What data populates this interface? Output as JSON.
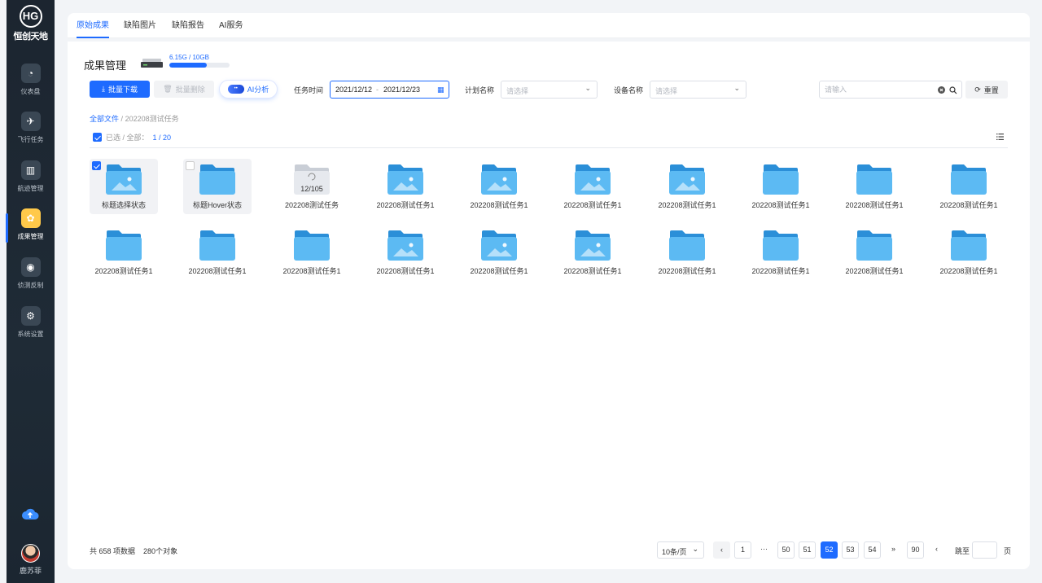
{
  "brand": {
    "mark": "HG",
    "name": "恒创天地"
  },
  "sidebar": {
    "items": [
      {
        "label": "仪表盘",
        "icon": "gauge-icon",
        "active": false
      },
      {
        "label": "飞行任务",
        "icon": "plane-icon",
        "active": false
      },
      {
        "label": "航迹管理",
        "icon": "map-icon",
        "active": false
      },
      {
        "label": "成果管理",
        "icon": "results-icon",
        "active": true
      },
      {
        "label": "侦测反制",
        "icon": "radar-icon",
        "active": false
      },
      {
        "label": "系统设置",
        "icon": "gear-icon",
        "active": false
      }
    ],
    "user_name": "鹿苏菲"
  },
  "tabs": [
    {
      "label": "原始成果",
      "active": true
    },
    {
      "label": "缺陷图片",
      "active": false
    },
    {
      "label": "缺陷报告",
      "active": false
    },
    {
      "label": "AI服务",
      "active": false
    }
  ],
  "header": {
    "title": "成果管理",
    "storage_text": "6.15G / 10GB",
    "storage_fraction": 0.615
  },
  "toolbar": {
    "download_label": "批量下载",
    "delete_label": "批量删除",
    "ai_label": "AI分析",
    "ai_glyph": "••",
    "task_time_label": "任务时间",
    "date_start": "2021/12/12",
    "date_sep": "-",
    "date_end": "2021/12/23",
    "plan_label": "计划名称",
    "plan_placeholder": "请选择",
    "device_label": "设备名称",
    "device_placeholder": "请选择",
    "search_placeholder": "请输入",
    "reset_label": "重置"
  },
  "breadcrumb": {
    "root": "全部文件",
    "sep": "/",
    "current": "202208测试任务"
  },
  "selection": {
    "label": "已选 / 全部：",
    "count": "1 / 20"
  },
  "grid": {
    "row1": [
      {
        "label": "标题选择状态",
        "kind": "image",
        "state": "selected"
      },
      {
        "label": "标题Hover状态",
        "kind": "plain",
        "state": "hover"
      },
      {
        "label": "202208测试任务",
        "kind": "loading",
        "progress": "12/105"
      },
      {
        "label": "202208测试任务1",
        "kind": "image"
      },
      {
        "label": "202208测试任务1",
        "kind": "image"
      },
      {
        "label": "202208测试任务1",
        "kind": "image"
      },
      {
        "label": "202208测试任务1",
        "kind": "image"
      },
      {
        "label": "202208测试任务1",
        "kind": "plain"
      },
      {
        "label": "202208测试任务1",
        "kind": "plain"
      },
      {
        "label": "202208测试任务1",
        "kind": "plain"
      }
    ],
    "row2": [
      {
        "label": "202208测试任务1",
        "kind": "plain"
      },
      {
        "label": "202208测试任务1",
        "kind": "plain"
      },
      {
        "label": "202208测试任务1",
        "kind": "plain"
      },
      {
        "label": "202208测试任务1",
        "kind": "image"
      },
      {
        "label": "202208测试任务1",
        "kind": "image"
      },
      {
        "label": "202208测试任务1",
        "kind": "image"
      },
      {
        "label": "202208测试任务1",
        "kind": "plain"
      },
      {
        "label": "202208测试任务1",
        "kind": "plain"
      },
      {
        "label": "202208测试任务1",
        "kind": "plain"
      },
      {
        "label": "202208测试任务1",
        "kind": "plain"
      }
    ]
  },
  "footer": {
    "total_text": "共 658 项数据",
    "objects_text": "280个对象",
    "page_size": "10条/页",
    "prev": "‹",
    "next": "‹",
    "fast_forward": "»",
    "ellipsis": "···",
    "pages": [
      "1",
      "50",
      "51",
      "52",
      "53",
      "54",
      "90"
    ],
    "current_page": "52",
    "jump_label": "跳至",
    "page_suffix": "页"
  },
  "colors": {
    "accent": "#1e6bff",
    "folder": "#58b7f2",
    "sidebar": "#1e2833"
  }
}
